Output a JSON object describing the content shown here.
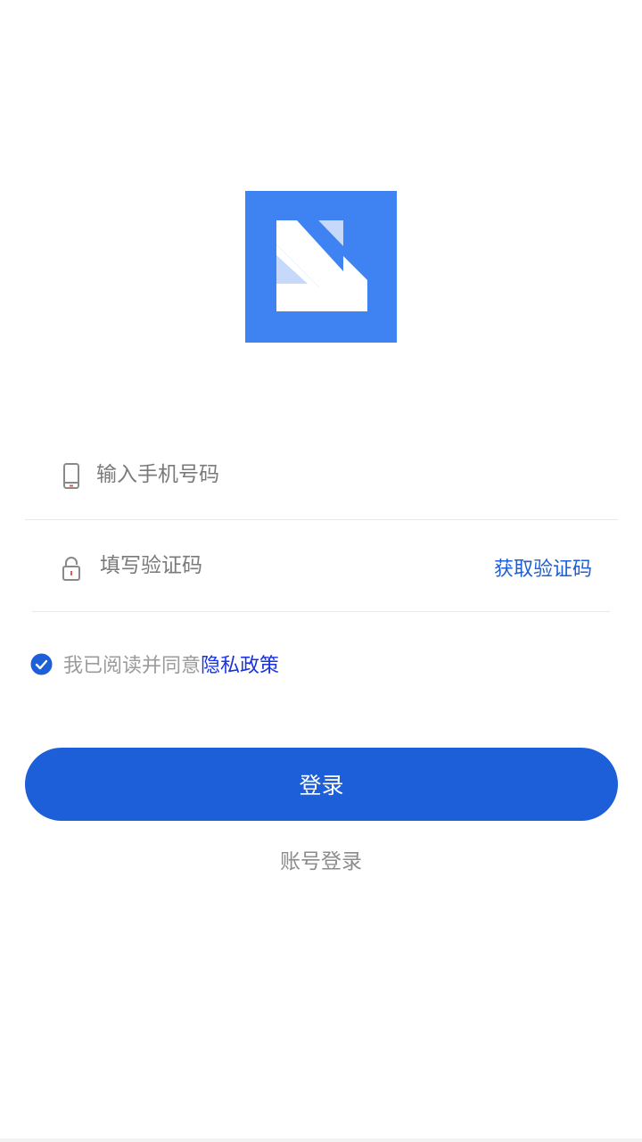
{
  "logo": {
    "icon": "app-logo-arrow",
    "color": "#3f82f1"
  },
  "form": {
    "phone_placeholder": "输入手机号码",
    "phone_icon": "phone-icon",
    "code_placeholder": "填写验证码",
    "code_icon": "lock-icon",
    "get_code_label": "获取验证码"
  },
  "agreement": {
    "checked": true,
    "text": "我已阅读并同意",
    "link_label": "隐私政策"
  },
  "actions": {
    "login_label": "登录",
    "account_login_label": "账号登录"
  },
  "colors": {
    "accent": "#1d5fd8",
    "link": "#1a33e0",
    "logo": "#3f82f1"
  }
}
